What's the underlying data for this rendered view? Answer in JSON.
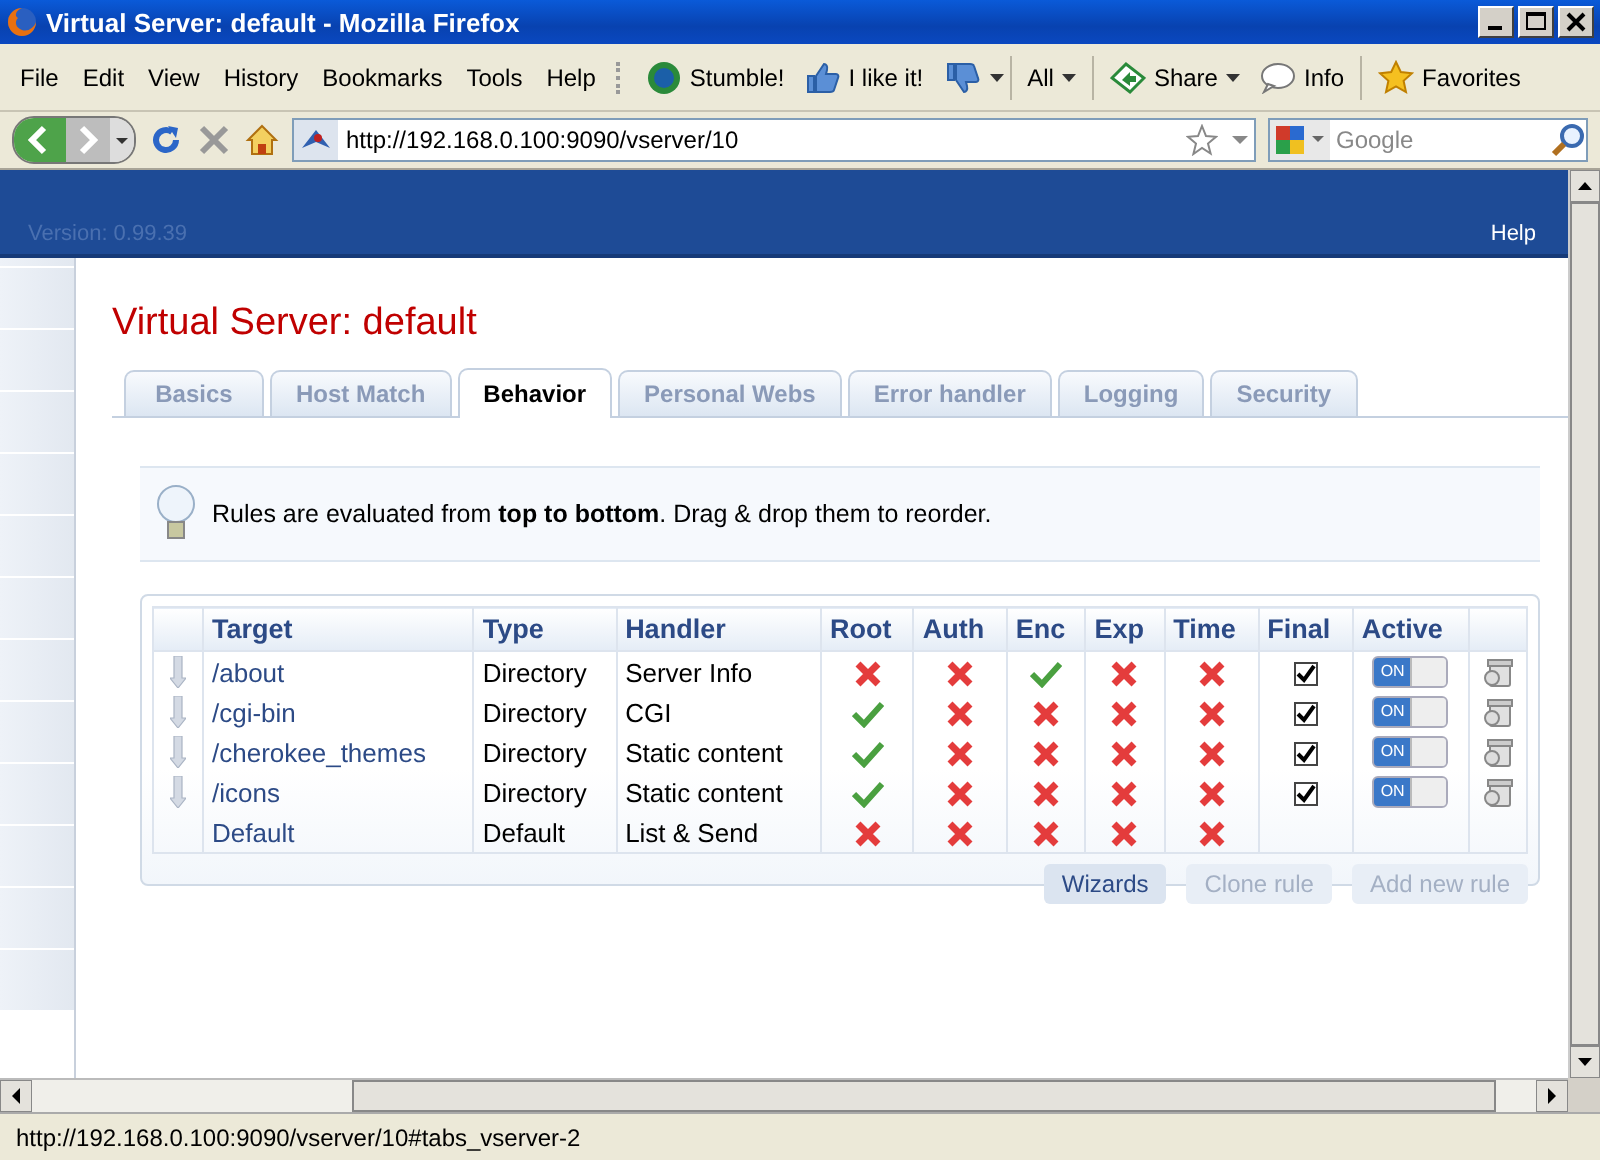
{
  "window": {
    "title": "Virtual Server: default - Mozilla Firefox"
  },
  "menu": [
    "File",
    "Edit",
    "View",
    "History",
    "Bookmarks",
    "Tools",
    "Help"
  ],
  "toolbar": [
    {
      "kind": "stumble",
      "label": "Stumble!"
    },
    {
      "kind": "like",
      "label": "I like it!"
    },
    {
      "kind": "dislike"
    },
    {
      "kind": "all",
      "label": "All"
    },
    {
      "kind": "share",
      "label": "Share"
    },
    {
      "kind": "info",
      "label": "Info"
    },
    {
      "kind": "favorites",
      "label": "Favorites"
    }
  ],
  "address": {
    "value": "http://192.168.0.100:9090/vserver/10"
  },
  "search": {
    "placeholder": "Google"
  },
  "header": {
    "version": "Version: 0.99.39",
    "help": "Help"
  },
  "page_title": "Virtual Server: default",
  "tabs": [
    {
      "label": "Basics",
      "selected": false
    },
    {
      "label": "Host Match",
      "selected": false
    },
    {
      "label": "Behavior",
      "selected": true
    },
    {
      "label": "Personal Webs",
      "selected": false
    },
    {
      "label": "Error handler",
      "selected": false
    },
    {
      "label": "Logging",
      "selected": false
    },
    {
      "label": "Security",
      "selected": false
    }
  ],
  "notice": "Rules are evaluated from **top to bottom**. Drag & drop them to reorder.",
  "table": {
    "columns": [
      "Target",
      "Type",
      "Handler",
      "Root",
      "Auth",
      "Enc",
      "Exp",
      "Time",
      "Final",
      "Active"
    ],
    "rows": [
      {
        "kind": "rule",
        "target": "/about",
        "type": "Directory",
        "handler": "Server Info",
        "root": false,
        "auth": false,
        "enc": true,
        "exp": false,
        "time": false,
        "final": true,
        "active": true,
        "active_label": "ON"
      },
      {
        "kind": "rule",
        "target": "/cgi-bin",
        "type": "Directory",
        "handler": "CGI",
        "root": true,
        "auth": false,
        "enc": false,
        "exp": false,
        "time": false,
        "final": true,
        "active": true,
        "active_label": "ON"
      },
      {
        "kind": "rule",
        "target": "/cherokee_themes",
        "type": "Directory",
        "handler": "Static content",
        "root": true,
        "auth": false,
        "enc": false,
        "exp": false,
        "time": false,
        "final": true,
        "active": true,
        "active_label": "ON"
      },
      {
        "kind": "rule",
        "target": "/icons",
        "type": "Directory",
        "handler": "Static content",
        "root": true,
        "auth": false,
        "enc": false,
        "exp": false,
        "time": false,
        "final": true,
        "active": true,
        "active_label": "ON"
      },
      {
        "kind": "default",
        "target": "Default",
        "type": "Default",
        "handler": "List & Send",
        "root": false,
        "auth": false,
        "enc": false,
        "exp": false,
        "time": false
      }
    ]
  },
  "buttons": [
    {
      "label": "Wizards",
      "disabled": false
    },
    {
      "label": "Clone rule",
      "disabled": true
    },
    {
      "label": "Add new rule",
      "disabled": true
    }
  ],
  "status_bar": "http://192.168.0.100:9090/vserver/10#tabs_vserver-2"
}
